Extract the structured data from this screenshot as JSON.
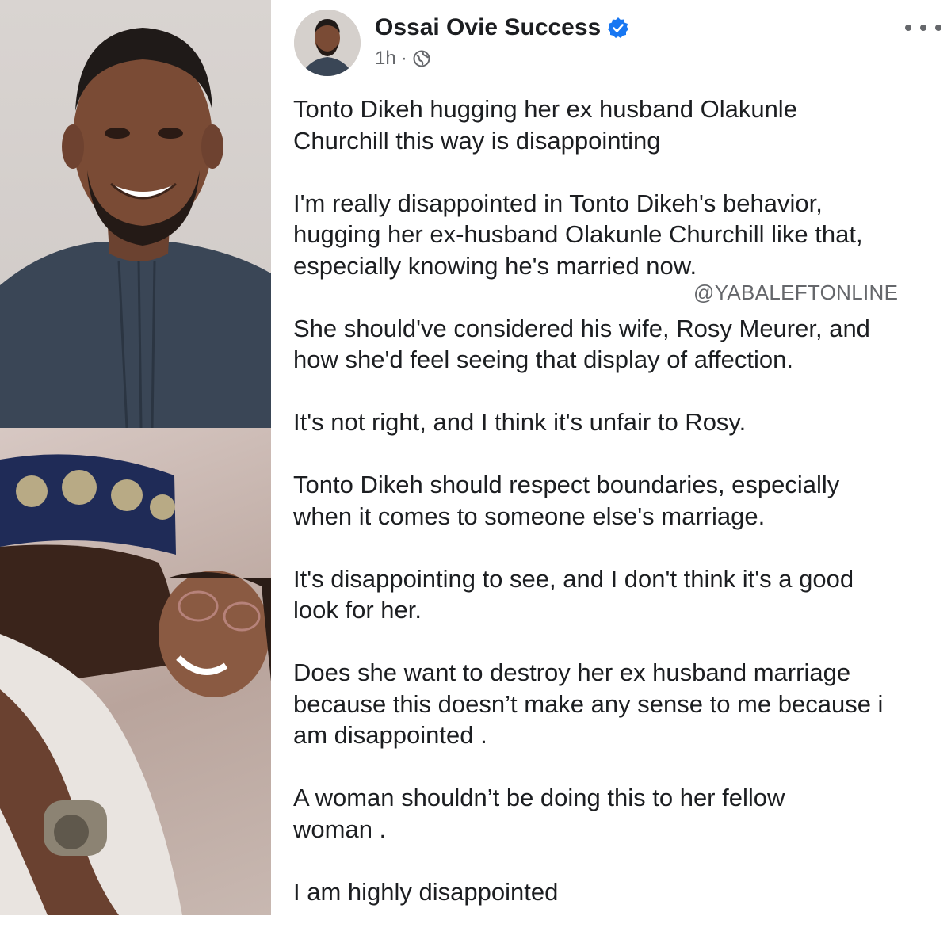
{
  "post": {
    "author_name": "Ossai Ovie Success",
    "time": "1h",
    "separator": "·",
    "verified": true,
    "more_icon": "more-options-icon",
    "paragraphs": [
      "Tonto Dikeh hugging her ex husband Olakunle\nChurchill this way is disappointing",
      "I'm really disappointed in Tonto Dikeh's behavior,\nhugging her ex-husband Olakunle Churchill like that,\nespecially knowing he's married now.",
      "She should've considered his wife, Rosy Meurer, and\nhow she'd feel seeing that display of affection.",
      "It's not right, and I think it's unfair to Rosy.",
      "Tonto Dikeh should respect boundaries, especially\nwhen it comes to someone else's marriage.",
      "It's disappointing to see, and I don't think it's a good\nlook for her.",
      "Does she want to destroy her ex husband marriage\nbecause this doesn’t make any sense to me because i\nam disappointed .",
      "A woman shouldn’t be doing this to her fellow\nwoman .",
      "I am highly disappointed"
    ]
  },
  "watermark": "@YABALEFTONLINE",
  "colors": {
    "verified_blue": "#1877f2",
    "meta_gray": "#65676b",
    "text": "#1c1e21"
  }
}
